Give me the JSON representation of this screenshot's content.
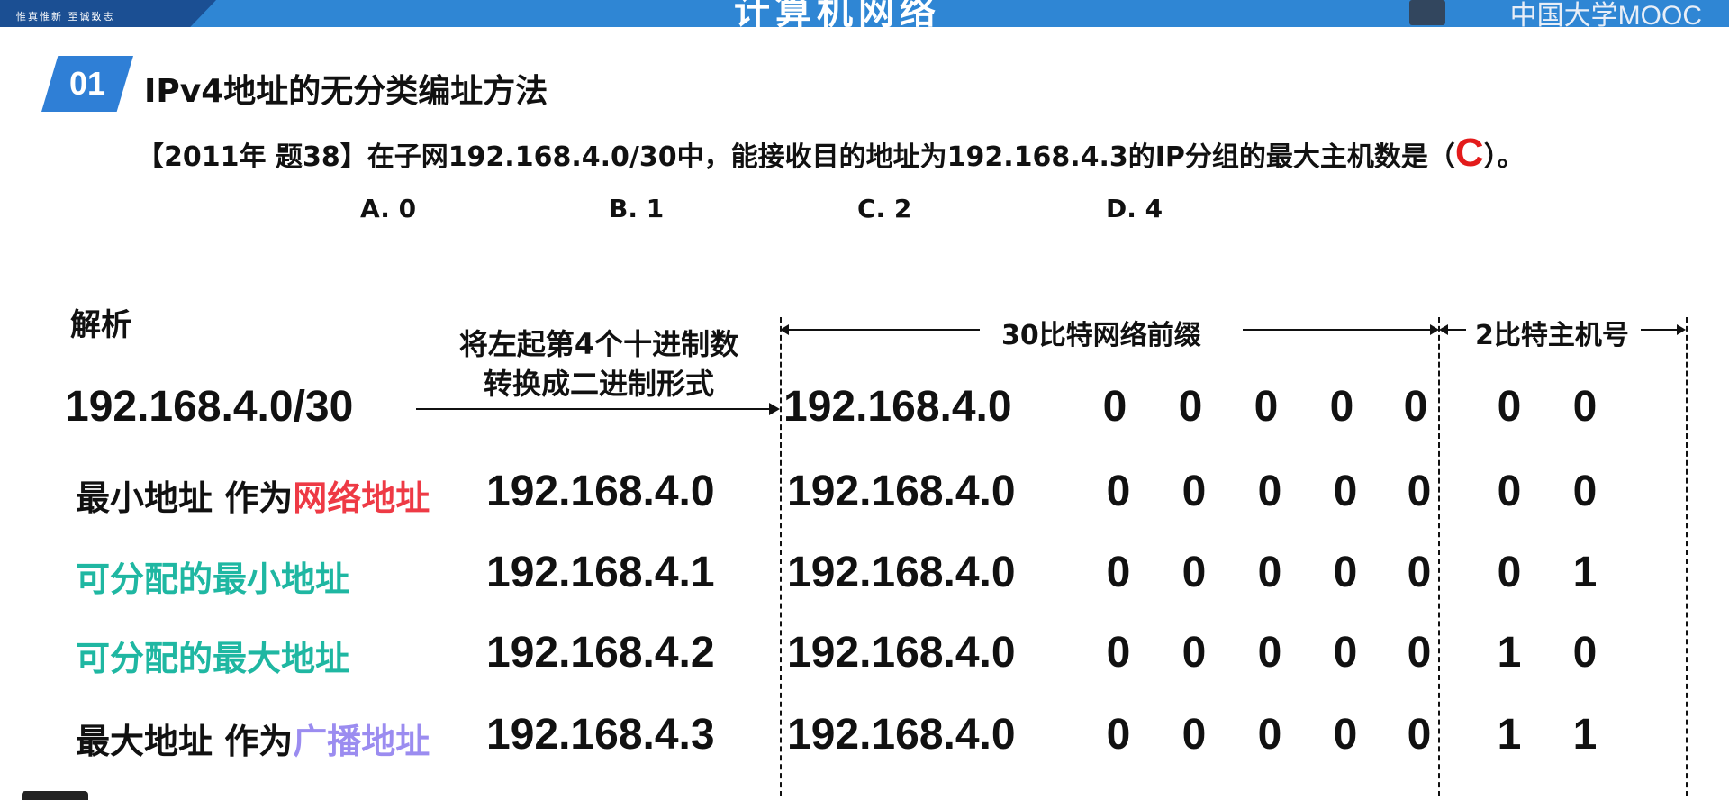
{
  "header": {
    "motto": "惟真惟新 至诚致志",
    "title": "计算机网络",
    "brand": "中国大学MOOC"
  },
  "section": {
    "number": "01",
    "title": "IPv4地址的无分类编址方法"
  },
  "question": {
    "prefix": "【2011年 题38】在子网192.168.4.0/30中，能接收目的地址为192.168.4.3的IP分组的最大主机数是（",
    "answer": "C",
    "suffix": "）。",
    "options": [
      "A. 0",
      "B. 1",
      "C. 2",
      "D. 4"
    ]
  },
  "analysis": {
    "label": "解析",
    "subnet": "192.168.4.0/30",
    "note_line1": "将左起第4个十进制数",
    "note_line2": "转换成二进制形式",
    "network_prefix_label": "30比特网络前缀",
    "host_label": "2比特主机号",
    "prefix_text": "192.168.4.0",
    "header_bits": [
      "0",
      "0",
      "0",
      "0",
      "0",
      "0",
      "0"
    ],
    "rows": [
      {
        "label_main": "最小地址  作为",
        "label_colored": "网络地址",
        "color": "#ee3a45",
        "address": "192.168.4.0",
        "bits": [
          "0",
          "0",
          "0",
          "0",
          "0",
          "0",
          "0"
        ]
      },
      {
        "label_main": "",
        "label_colored": "可分配的最小地址",
        "color": "#1fb7a2",
        "address": "192.168.4.1",
        "bits": [
          "0",
          "0",
          "0",
          "0",
          "0",
          "0",
          "1"
        ]
      },
      {
        "label_main": "",
        "label_colored": "可分配的最大地址",
        "color": "#1fb7a2",
        "address": "192.168.4.2",
        "bits": [
          "0",
          "0",
          "0",
          "0",
          "0",
          "1",
          "0"
        ]
      },
      {
        "label_main": "最大地址  作为",
        "label_colored": "广播地址",
        "color": "#9b8cf0",
        "address": "192.168.4.3",
        "bits": [
          "0",
          "0",
          "0",
          "0",
          "0",
          "1",
          "1"
        ]
      }
    ]
  }
}
